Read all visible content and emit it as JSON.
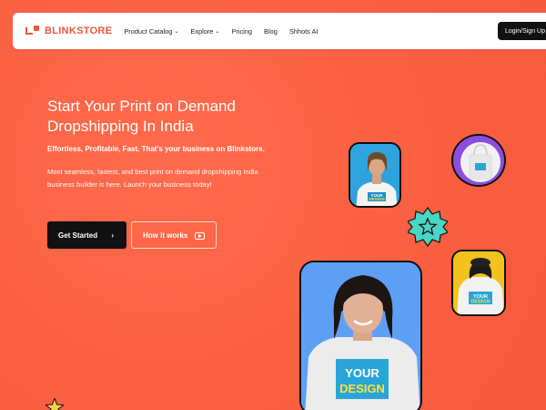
{
  "brand": {
    "name": "BLINKSTORE",
    "color": "#f0563a"
  },
  "nav": {
    "items": [
      {
        "label": "Product Catalog",
        "dropdown": true
      },
      {
        "label": "Explore",
        "dropdown": true
      },
      {
        "label": "Pricing",
        "dropdown": false
      },
      {
        "label": "Blog",
        "dropdown": false
      },
      {
        "label": "Shhots AI",
        "dropdown": false
      }
    ],
    "login_label": "Login/Sign Up"
  },
  "hero": {
    "headline_line1": "Start Your Print on Demand",
    "headline_line2": "Dropshipping In India",
    "tagline": "Effortless, Profitable, Fast. That’s your business on Blinkstore.",
    "description": "Most seamless, fastest, and best print on demand dropshipping India business builder is here. Launch your business today!",
    "primary_cta": "Get Started",
    "primary_cta_icon": "chevron-right-icon",
    "secondary_cta": "How it works",
    "secondary_cta_icon": "play-icon"
  },
  "visuals": {
    "print_text_line1": "YOUR",
    "print_text_line2": "DESIGN",
    "background_color": "#f95d3f",
    "accent_teal": "#49d6c4"
  }
}
